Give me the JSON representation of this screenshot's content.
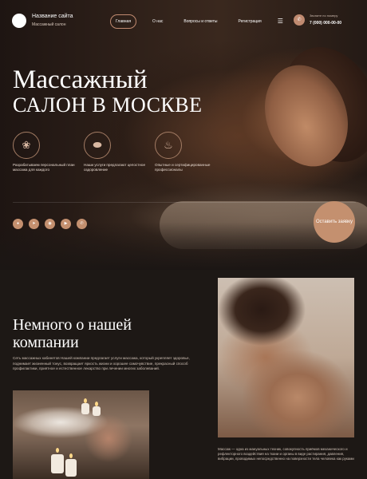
{
  "header": {
    "site_name": "Название сайта",
    "site_subtitle": "Массажный салон",
    "nav": [
      "Главная",
      "О нас",
      "Вопросы и ответы",
      "Регистрация"
    ],
    "phone_label": "Звоните по номеру",
    "phone_number": "7 (000) 000-00-00"
  },
  "hero": {
    "title_line1": "Массажный",
    "title_line2": "САЛОН В МОСКВЕ",
    "features": [
      {
        "icon": "spa-icon",
        "text": "Разрабатываем персональный план массажа для каждого"
      },
      {
        "icon": "stones-icon",
        "text": "Наши услуги предлагают целостное оздоровление"
      },
      {
        "icon": "candles-icon",
        "text": "Опытные и сертифицированные профессионалы"
      }
    ],
    "social": [
      "vk",
      "tg",
      "ok",
      "yt",
      "wa"
    ],
    "cta": "Оставить заявку"
  },
  "about": {
    "title": "Немного о нашей компании",
    "text": "Сеть массажных кабинетов Нашей компании предлагает услуги массажа, который укрепляет здоровье, поднимает жизненный тонус, возвращает яркость жизни и хорошее самочувствие, прекрасный способ профилактики, приятное и естественное лекарство при лечении многих заболеваний.",
    "caption": "Массаж — одна из мануальных техник, совокупность приёмов механического и рефлекторного воздействия на ткани и органы в виде растирания, давления, вибрации, проводимых непосредственно на поверхности тела человека как руками"
  },
  "colors": {
    "accent": "#c4906f",
    "background": "#1b1614"
  }
}
